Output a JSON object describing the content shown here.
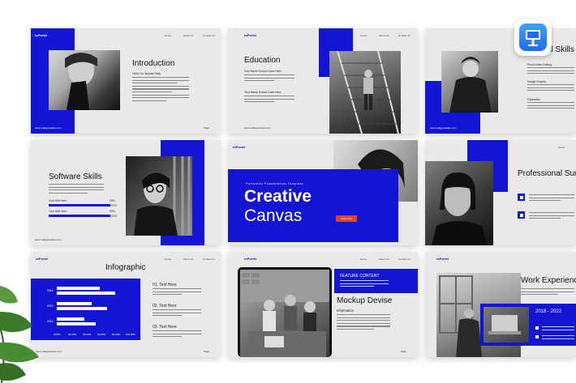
{
  "brand": "toPortel",
  "nav": {
    "home": "Home",
    "about": "About Us",
    "contact": "Contact Us"
  },
  "site_url": "www.reallygreatsite.com",
  "page_label": "Page",
  "app_icon": "keynote-icon",
  "colors": {
    "accent": "#1414d4",
    "slide_bg": "#e9e9e9",
    "button": "#e8401c"
  },
  "slides": {
    "intro": {
      "title": "Introduction",
      "subtitle": "Hello! I'm Jessica Rotty"
    },
    "education": {
      "title": "Education",
      "school1": "Your Name School Goes Here",
      "school2": "Your Name School Goes Here"
    },
    "skills_top": {
      "title": "al Skills",
      "items": [
        "Photo/Video Editing",
        "Design Graphic",
        "Filmmaker"
      ]
    },
    "software": {
      "title": "Software Skills",
      "bar1_label": "Your Skill Here",
      "bar1_value": "90%",
      "bar1_fraction": 0.9,
      "bar2_label": "Your Skill Here",
      "bar2_value": "90%",
      "bar2_fraction": 0.9
    },
    "cover": {
      "tagline": "Portofolio Presentation Template",
      "title1": "Creative",
      "title2": "Canvas",
      "button": "Start Here"
    },
    "professional": {
      "title": "Professional Sum"
    },
    "infographic": {
      "title": "Infographic",
      "years": [
        "2014",
        "2013",
        "2012"
      ],
      "fractions": [
        0.55,
        0.75,
        0.45,
        0.65,
        0.35,
        0.5
      ],
      "axis": [
        "0,00%",
        "20,00%",
        "40,00%",
        "60,00%",
        "80,00%",
        "100,00%"
      ],
      "items": [
        "01.  Text Here",
        "02.  Text Here",
        "03.  Text Here"
      ]
    },
    "mockup": {
      "feature": "FEATURE CONTENT",
      "title": "Mockup Devise",
      "subtitle": "Information"
    },
    "work": {
      "title": "Work Experience",
      "years": "2018 - 2022"
    }
  }
}
